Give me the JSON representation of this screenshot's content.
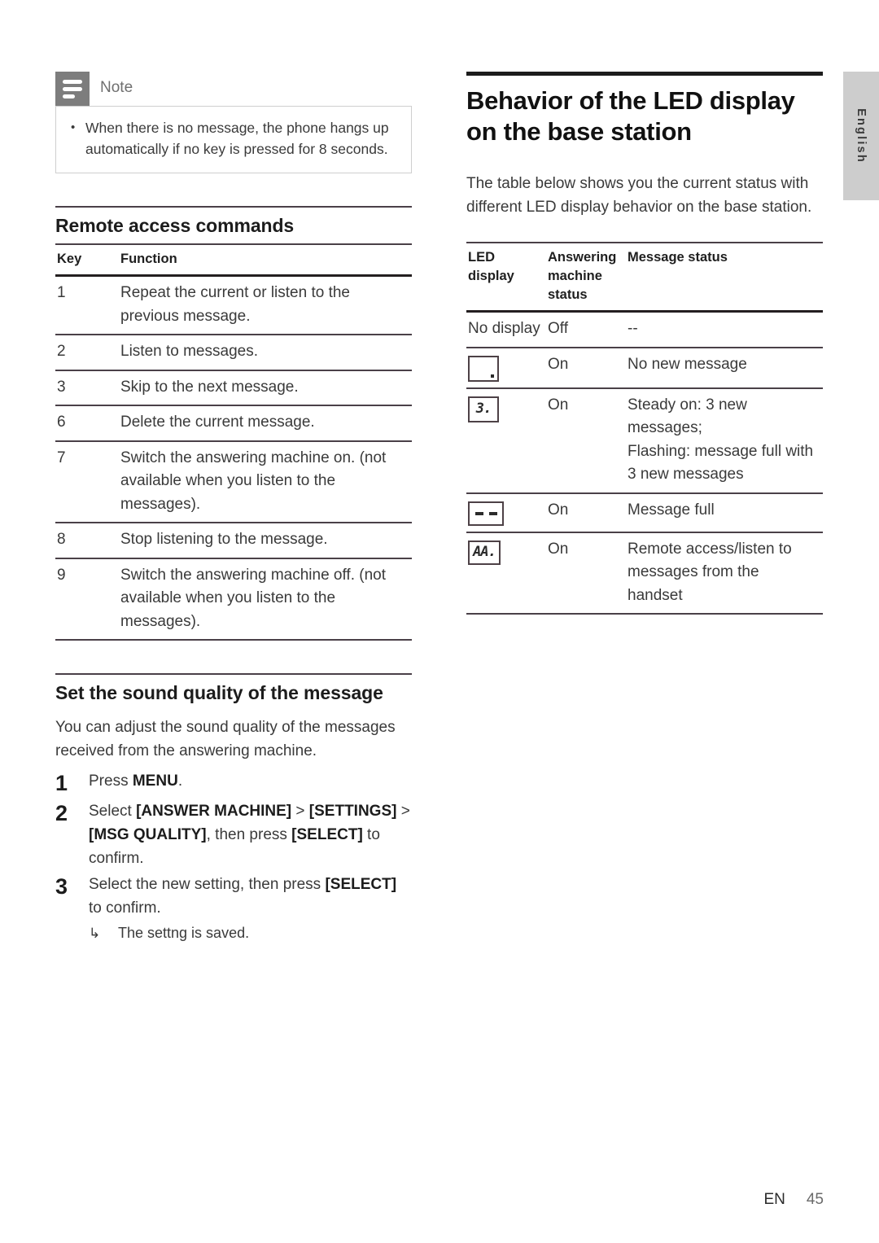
{
  "language_tab": {
    "label": "English"
  },
  "note": {
    "icon": "note-lines-icon",
    "title": "Note",
    "items": [
      "When there is no message, the phone hangs up automatically if no key is pressed for 8 seconds."
    ]
  },
  "left_column": {
    "section_remote": {
      "title": "Remote access commands",
      "table": {
        "headers": [
          "Key",
          "Function"
        ],
        "rows": [
          [
            "1",
            "Repeat the current or listen to the previous message."
          ],
          [
            "2",
            "Listen to messages."
          ],
          [
            "3",
            "Skip to the next message."
          ],
          [
            "6",
            "Delete the current message."
          ],
          [
            "7",
            "Switch the answering machine on. (not available when you listen to the messages)."
          ],
          [
            "8",
            "Stop listening to the message."
          ],
          [
            "9",
            "Switch the answering machine off. (not available when you listen to the messages)."
          ]
        ]
      }
    },
    "section_sound": {
      "title": "Set the sound quality of the message",
      "intro": "You can adjust the sound quality of the messages received from the answering machine.",
      "steps": [
        {
          "num": "1",
          "parts": [
            {
              "t": "Press ",
              "b": false
            },
            {
              "t": "MENU",
              "b": true
            },
            {
              "t": ".",
              "b": false
            }
          ]
        },
        {
          "num": "2",
          "parts": [
            {
              "t": "Select ",
              "b": false
            },
            {
              "t": "[ANSWER MACHINE]",
              "b": true
            },
            {
              "t": " > ",
              "b": false
            },
            {
              "t": "[SETTINGS]",
              "b": true
            },
            {
              "t": " > ",
              "b": false
            },
            {
              "t": "[MSG QUALITY]",
              "b": true
            },
            {
              "t": ", then press ",
              "b": false
            },
            {
              "t": "[SELECT]",
              "b": true
            },
            {
              "t": " to confirm.",
              "b": false
            }
          ]
        },
        {
          "num": "3",
          "parts": [
            {
              "t": "Select the new setting, then press ",
              "b": false
            },
            {
              "t": "[SELECT]",
              "b": true
            },
            {
              "t": " to confirm.",
              "b": false
            }
          ],
          "substep": {
            "arrow": "↳",
            "text": "The settng is saved."
          }
        }
      ]
    }
  },
  "right_column": {
    "heading": "Behavior of the LED display on the base station",
    "intro": "The table below shows you the current status with different LED display behavior on the base station.",
    "table": {
      "headers": [
        "LED display",
        "Answering machine status",
        "Message status"
      ],
      "rows": [
        {
          "led_kind": "text",
          "led_text": "No display",
          "am_status": "Off",
          "message_status": "--"
        },
        {
          "led_kind": "blank",
          "led_text": "",
          "am_status": "On",
          "message_status": "No new message"
        },
        {
          "led_kind": "digit",
          "led_text": "3.",
          "am_status": "On",
          "message_status": "Steady on: 3 new messages;\nFlashing: message full with 3 new messages"
        },
        {
          "led_kind": "dashes",
          "led_text": "- -",
          "am_status": "On",
          "message_status": "Message full"
        },
        {
          "led_kind": "digit",
          "led_text": "AA.",
          "am_status": "On",
          "message_status": "Remote access/listen to messages from the handset"
        }
      ]
    }
  },
  "footer": {
    "locale": "EN",
    "page": "45"
  }
}
